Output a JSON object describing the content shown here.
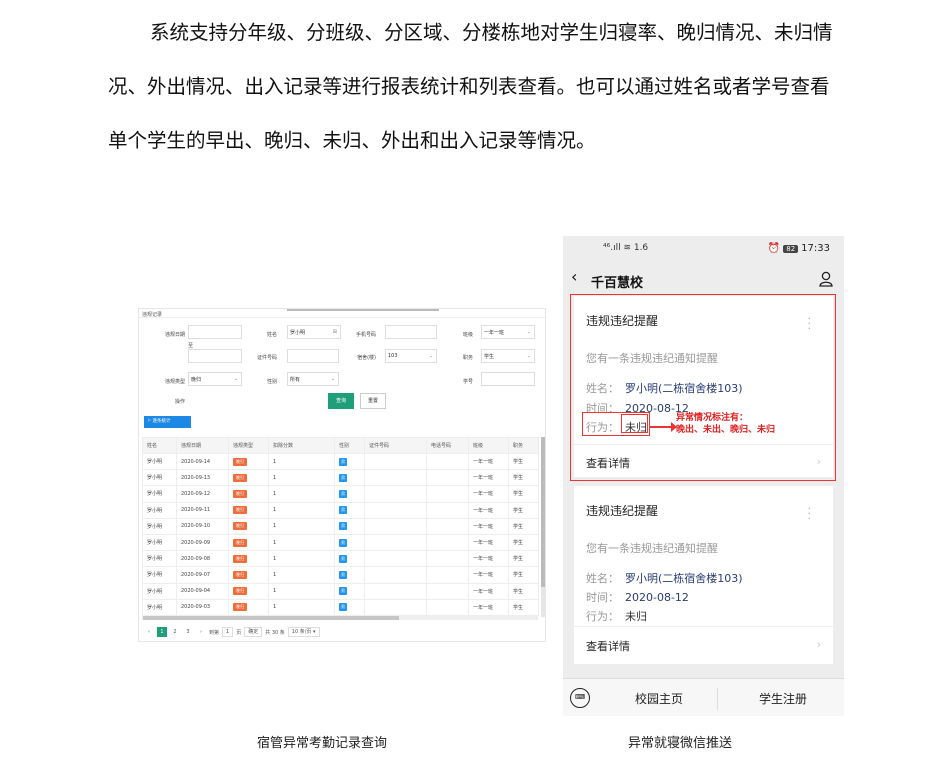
{
  "paragraph": "系统支持分年级、分班级、分区域、分楼栋地对学生归寝率、晚归情况、未归情况、外出情况、出入记录等进行报表统计和列表查看。也可以通过姓名或者学号查看单个学生的早出、晚归、未归、外出和出入记录等情况。",
  "admin": {
    "header": "违规记录",
    "filters": {
      "date_label": "违规日期",
      "date_to": "至",
      "name_label": "姓名",
      "name_value": "罗小明",
      "phone_label": "手机号码",
      "class_label": "班级",
      "class_value": "一年一班",
      "id_label": "证件号码",
      "dorm_label": "宿舍(楼)",
      "dorm_value": "103",
      "post_label": "职务",
      "post_value": "学生",
      "type_label": "违规类型",
      "type_value": "晚归",
      "sex_label": "性别",
      "sex_value": "所有",
      "stuno_label": "学号",
      "action_label": "操作",
      "query": "查询",
      "reset": "重置",
      "stat": "逐条统计"
    },
    "columns": [
      "姓名",
      "违规日期",
      "违规类型",
      "扣除分数",
      "性别",
      "证件号码",
      "电话号码",
      "班级",
      "职务"
    ],
    "rows": [
      {
        "name": "罗小明",
        "date": "2020-09-14",
        "type": "晚归",
        "score": "1",
        "sex": "男",
        "idno": "",
        "phone": "",
        "cls": "一年一班",
        "post": "学生"
      },
      {
        "name": "罗小明",
        "date": "2020-09-13",
        "type": "晚归",
        "score": "1",
        "sex": "男",
        "idno": "",
        "phone": "",
        "cls": "一年一班",
        "post": "学生"
      },
      {
        "name": "罗小明",
        "date": "2020-09-12",
        "type": "晚归",
        "score": "1",
        "sex": "男",
        "idno": "",
        "phone": "",
        "cls": "一年一班",
        "post": "学生"
      },
      {
        "name": "罗小明",
        "date": "2020-09-11",
        "type": "晚归",
        "score": "1",
        "sex": "男",
        "idno": "",
        "phone": "",
        "cls": "一年一班",
        "post": "学生"
      },
      {
        "name": "罗小明",
        "date": "2020-09-10",
        "type": "晚归",
        "score": "1",
        "sex": "男",
        "idno": "",
        "phone": "",
        "cls": "一年一班",
        "post": "学生"
      },
      {
        "name": "罗小明",
        "date": "2020-09-09",
        "type": "晚归",
        "score": "1",
        "sex": "男",
        "idno": "",
        "phone": "",
        "cls": "一年一班",
        "post": "学生"
      },
      {
        "name": "罗小明",
        "date": "2020-09-08",
        "type": "晚归",
        "score": "1",
        "sex": "男",
        "idno": "",
        "phone": "",
        "cls": "一年一班",
        "post": "学生"
      },
      {
        "name": "罗小明",
        "date": "2020-09-07",
        "type": "晚归",
        "score": "1",
        "sex": "男",
        "idno": "",
        "phone": "",
        "cls": "一年一班",
        "post": "学生"
      },
      {
        "name": "罗小明",
        "date": "2020-09-04",
        "type": "晚归",
        "score": "1",
        "sex": "男",
        "idno": "",
        "phone": "",
        "cls": "一年一班",
        "post": "学生"
      },
      {
        "name": "罗小明",
        "date": "2020-09-03",
        "type": "晚归",
        "score": "1",
        "sex": "男",
        "idno": "",
        "phone": "",
        "cls": "一年一班",
        "post": "学生"
      }
    ],
    "pager": {
      "prev": "‹",
      "pages": [
        "1",
        "2",
        "3"
      ],
      "next": "›",
      "goto": "到第",
      "goto_value": "1",
      "page_unit": "页",
      "confirm": "确定",
      "total": "共 30 条",
      "per_page": "10 条/页"
    }
  },
  "phone": {
    "status_mid": "⁴⁶.ıll ≋ 1.6",
    "battery": "82",
    "time": "17:33",
    "title": "千百慧校",
    "cards": [
      {
        "title": "违规违纪提醒",
        "sub": "您有一条违规违纪通知提醒",
        "name_label": "姓名：",
        "name": "罗小明(二栋宿舍楼103)",
        "time_label": "时间：",
        "time": "2020-08-12",
        "act_label": "行为：",
        "act": "未归",
        "detail": "查看详情"
      },
      {
        "title": "违规违纪提醒",
        "sub": "您有一条违规违纪通知提醒",
        "name_label": "姓名：",
        "name": "罗小明(二栋宿舍楼103)",
        "time_label": "时间：",
        "time": "2020-08-12",
        "act_label": "行为：",
        "act": "未归",
        "detail": "查看详情"
      }
    ],
    "note": [
      "异常情况标注有：",
      "晚出、未出、晚归、未归"
    ],
    "tabs": [
      "校园主页",
      "学生注册"
    ]
  },
  "captions": [
    "宿管异常考勤记录查询",
    "异常就寝微信推送"
  ],
  "colors": {
    "accent_green": "#1e9e79",
    "late_tag": "#ef6c3c",
    "annotation_red": "#e33333"
  }
}
